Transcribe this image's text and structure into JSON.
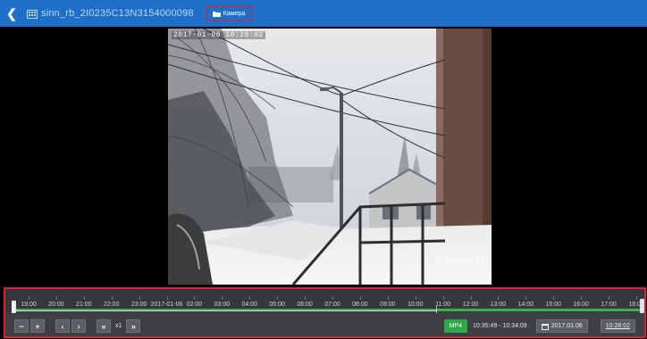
{
  "header": {
    "back_icon": "chevron-left-icon",
    "camera_icon": "camera-icon",
    "camera_title": "sinn_rb_2I0235C13N3154000098",
    "mode_icon": "folder-icon",
    "mode_label": "Камера"
  },
  "video": {
    "osd_timestamp": "2017-01-06 10:28:02",
    "osd_camera_name": "IP Camera 14"
  },
  "timeline": {
    "ticks": [
      "19:00",
      "20:00",
      "21:00",
      "22:00",
      "23:00",
      "2017-01-06",
      "02:00",
      "03:00",
      "04:00",
      "05:00",
      "06:00",
      "07:00",
      "08:00",
      "09:00",
      "10:00",
      "11:00",
      "12:00",
      "13:00",
      "14:00",
      "15:00",
      "16:00",
      "17:00",
      "18:00"
    ],
    "playhead_fraction": 0.67,
    "recording_color": "#3bb34a"
  },
  "controls": {
    "zoom_out_label": "−",
    "zoom_in_label": "+",
    "prev_label": "‹",
    "next_label": "›",
    "slower_label": "«",
    "speed_label": "x1",
    "faster_label": "»",
    "mp4_label": "MP4",
    "range_text": "10:35:49 - 10:34:09",
    "date_value": "2017.01.06",
    "date_icon": "calendar-icon",
    "time_value": "10:28:02"
  },
  "colors": {
    "header_bg": "#1e6fc8",
    "highlight_border": "#d6233a",
    "timeline_bg": "#3d3f44"
  }
}
